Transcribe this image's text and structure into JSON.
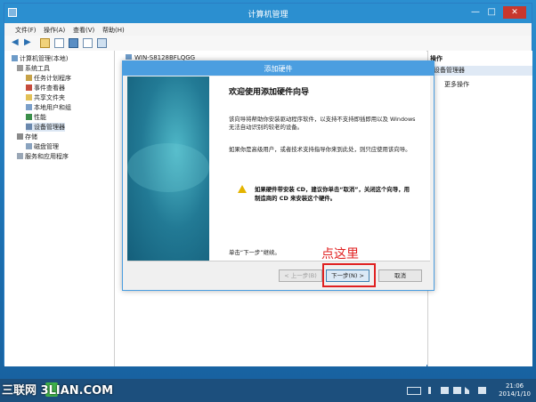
{
  "mmc": {
    "title": "计算机管理",
    "minimize": "—",
    "maximize": "□",
    "close": "✕",
    "menu": [
      "文件(F)",
      "操作(A)",
      "查看(V)",
      "帮助(H)"
    ],
    "tree": [
      {
        "label": "计算机管理(本地)"
      },
      {
        "label": "系统工具"
      },
      {
        "label": "任务计划程序"
      },
      {
        "label": "事件查看器"
      },
      {
        "label": "共享文件夹"
      },
      {
        "label": "本地用户和组"
      },
      {
        "label": "性能"
      },
      {
        "label": "设备管理器"
      },
      {
        "label": "存储"
      },
      {
        "label": "磁盘管理"
      },
      {
        "label": "服务和应用程序"
      }
    ],
    "host": "WIN-S8128BFLQGG",
    "actions": {
      "header": "操作",
      "section": "设备管理器",
      "more": "更多操作"
    }
  },
  "wizard": {
    "title": "添加硬件",
    "heading": "欢迎使用添加硬件向导",
    "para1": "该向导将帮助你安装驱动程序软件，以支持不支持即插即用以及 Windows 无法自动识别的较老的设备。",
    "para2": "如果你是高级用户，或者技术支持指导你来到此处，则只应使用该向导。",
    "warning": "如果硬件带安装 CD，建议你单击“取消”，关闭这个向导，用制造商的 CD 来安装这个硬件。",
    "footer": "单击“下一步”继续。",
    "back_label": "< 上一步(B)",
    "next_label": "下一步(N) >",
    "cancel_label": "取消"
  },
  "annotation": {
    "text": "点这里",
    "color": "#e02020"
  },
  "taskbar": {
    "time": "21:06",
    "date": "2014/1/10",
    "watermark": "三联网 3LIAN.COM"
  }
}
